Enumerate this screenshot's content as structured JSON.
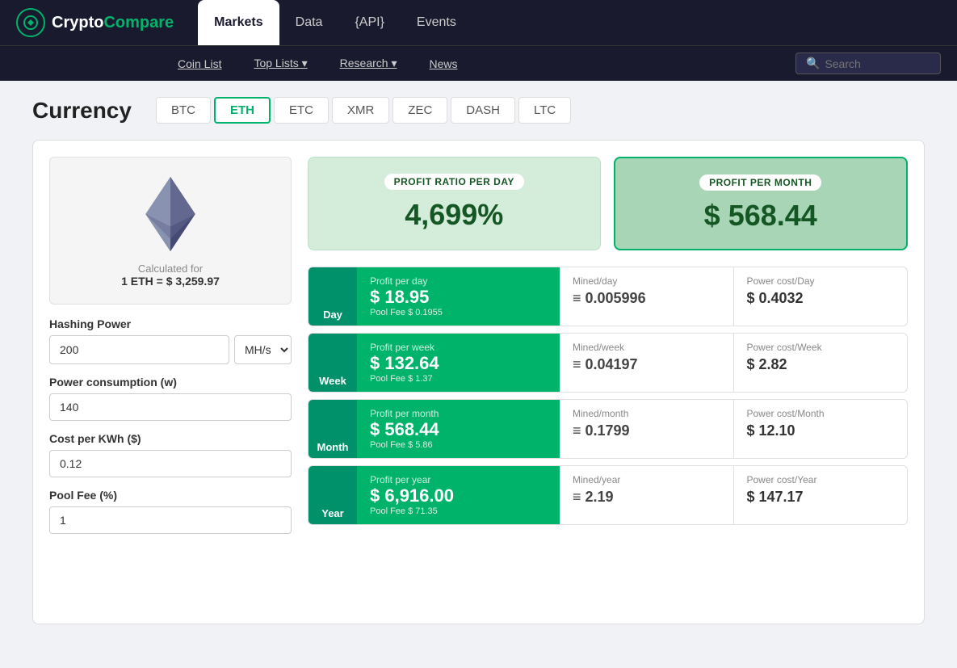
{
  "logo": {
    "text_crypto": "Crypto",
    "text_compare": "Compare"
  },
  "nav": {
    "items": [
      {
        "label": "Markets",
        "active": true
      },
      {
        "label": "Data",
        "active": false
      },
      {
        "label": "{API}",
        "active": false
      },
      {
        "label": "Events",
        "active": false
      }
    ]
  },
  "secondary_nav": {
    "items": [
      {
        "label": "Coin List"
      },
      {
        "label": "Top Lists ▾"
      },
      {
        "label": "Research ▾"
      },
      {
        "label": "News"
      }
    ],
    "search_placeholder": "Search"
  },
  "currency": {
    "title": "Currency",
    "tabs": [
      "BTC",
      "ETH",
      "ETC",
      "XMR",
      "ZEC",
      "DASH",
      "LTC"
    ],
    "active_tab": "ETH"
  },
  "left_panel": {
    "calculated_for": "Calculated for",
    "eth_price": "1 ETH = $ 3,259.97",
    "hashing_power_label": "Hashing Power",
    "hashing_power_value": "200",
    "hashing_power_unit": "MH/s",
    "power_consumption_label": "Power consumption (w)",
    "power_consumption_value": "140",
    "cost_per_kwh_label": "Cost per KWh ($)",
    "cost_per_kwh_value": "0.12",
    "pool_fee_label": "Pool Fee (%)",
    "pool_fee_value": "1"
  },
  "stat_boxes": [
    {
      "label": "PROFIT RATIO PER DAY",
      "value": "4,699%",
      "style": "light"
    },
    {
      "label": "PROFIT PER MONTH",
      "value": "$ 568.44",
      "style": "dark"
    }
  ],
  "profit_rows": [
    {
      "period_label": "Day",
      "profit_title": "Profit per day",
      "profit_value": "$ 18.95",
      "pool_fee": "Pool Fee $ 0.1955",
      "mined_label": "Mined/day",
      "mined_value": "≡ 0.005996",
      "power_label": "Power cost/Day",
      "power_value": "$ 0.4032"
    },
    {
      "period_label": "Week",
      "profit_title": "Profit per week",
      "profit_value": "$ 132.64",
      "pool_fee": "Pool Fee $ 1.37",
      "mined_label": "Mined/week",
      "mined_value": "≡ 0.04197",
      "power_label": "Power cost/Week",
      "power_value": "$ 2.82"
    },
    {
      "period_label": "Month",
      "profit_title": "Profit per month",
      "profit_value": "$ 568.44",
      "pool_fee": "Pool Fee $ 5.86",
      "mined_label": "Mined/month",
      "mined_value": "≡ 0.1799",
      "power_label": "Power cost/Month",
      "power_value": "$ 12.10"
    },
    {
      "period_label": "Year",
      "profit_title": "Profit per year",
      "profit_value": "$ 6,916.00",
      "pool_fee": "Pool Fee $ 71.35",
      "mined_label": "Mined/year",
      "mined_value": "≡ 2.19",
      "power_label": "Power cost/Year",
      "power_value": "$ 147.17"
    }
  ]
}
